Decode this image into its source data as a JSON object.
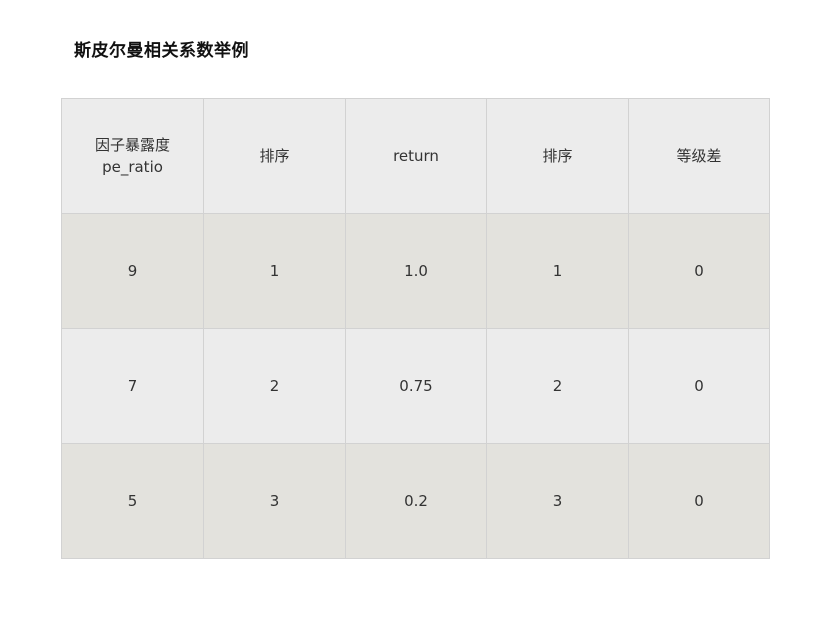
{
  "document": {
    "title": "斯皮尔曼相关系数举例"
  },
  "table": {
    "headers": [
      {
        "lines": [
          "因子暴露度",
          "pe_ratio"
        ]
      },
      {
        "lines": [
          "排序"
        ]
      },
      {
        "lines": [
          "return"
        ]
      },
      {
        "lines": [
          "排序"
        ]
      },
      {
        "lines": [
          "等级差"
        ]
      }
    ],
    "rows": [
      [
        "9",
        "1",
        "1.0",
        "1",
        "0"
      ],
      [
        "7",
        "2",
        "0.75",
        "2",
        "0"
      ],
      [
        "5",
        "3",
        "0.2",
        "3",
        "0"
      ]
    ]
  },
  "colors": {
    "header_bg": "#ececec",
    "row_odd_bg": "#e3e2dd",
    "row_even_bg": "#ececec",
    "border": "#d2d2d2"
  }
}
